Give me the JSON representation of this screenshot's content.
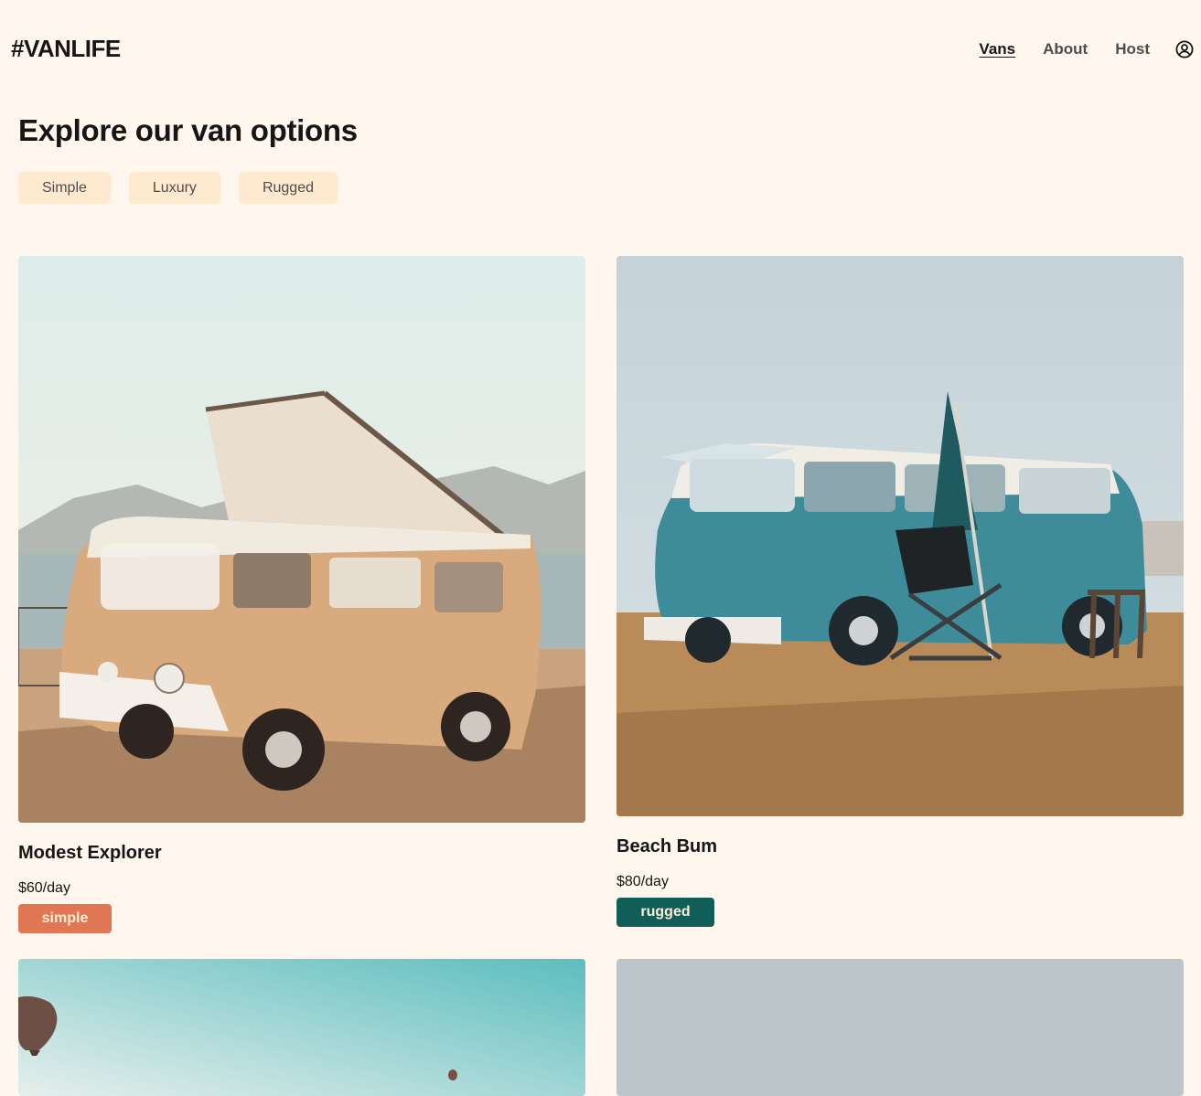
{
  "header": {
    "logo": "#VANLIFE",
    "nav": [
      {
        "label": "Vans",
        "active": true
      },
      {
        "label": "About",
        "active": false
      },
      {
        "label": "Host",
        "active": false
      }
    ],
    "user_icon": "user-circle-icon"
  },
  "main": {
    "title": "Explore our van options",
    "filters": [
      "Simple",
      "Luxury",
      "Rugged"
    ]
  },
  "vans": [
    {
      "name": "Modest Explorer",
      "price": "$60/day",
      "type": "simple",
      "badge_color": "#E17654"
    },
    {
      "name": "Beach Bum",
      "price": "$80/day",
      "type": "rugged",
      "badge_color": "#115E59"
    },
    {
      "name": "",
      "price": "",
      "type": "",
      "badge_color": ""
    },
    {
      "name": "",
      "price": "",
      "type": "",
      "badge_color": ""
    }
  ],
  "colors": {
    "background": "#FFF7ED",
    "filter_bg": "#FFEAD0",
    "text": "#161616",
    "nav_text": "#4D4D4D"
  }
}
